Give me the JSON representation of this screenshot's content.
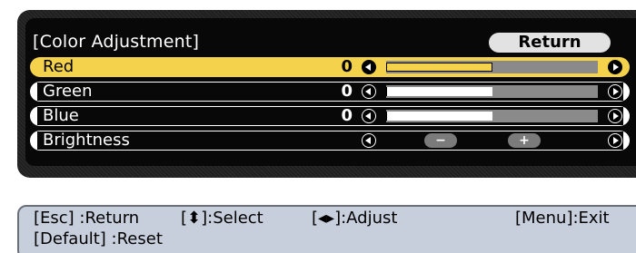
{
  "menu": {
    "title": "[Color Adjustment]",
    "return_label": "Return",
    "rows": [
      {
        "label": "Red",
        "value": "0",
        "level": 0.5,
        "control": "slider",
        "selected": true
      },
      {
        "label": "Green",
        "value": "0",
        "level": 0.5,
        "control": "slider",
        "selected": false
      },
      {
        "label": "Blue",
        "value": "0",
        "level": 0.5,
        "control": "slider",
        "selected": false
      },
      {
        "label": "Brightness",
        "value": "",
        "control": "buttons",
        "minus_label": "−",
        "plus_label": "+",
        "selected": false
      }
    ]
  },
  "help": {
    "esc": "[Esc] :Return",
    "select": "[⬍]:Select",
    "adjust": "[◂▸]:Adjust",
    "menu": "[Menu]:Exit",
    "default": "[Default] :Reset"
  },
  "colors": {
    "panel_bg": "#080808",
    "highlight": "#f5d24b",
    "button_bg": "#e2e2e2",
    "slider_track": "#8a8a8a",
    "help_bg": "#c8cfdc"
  }
}
